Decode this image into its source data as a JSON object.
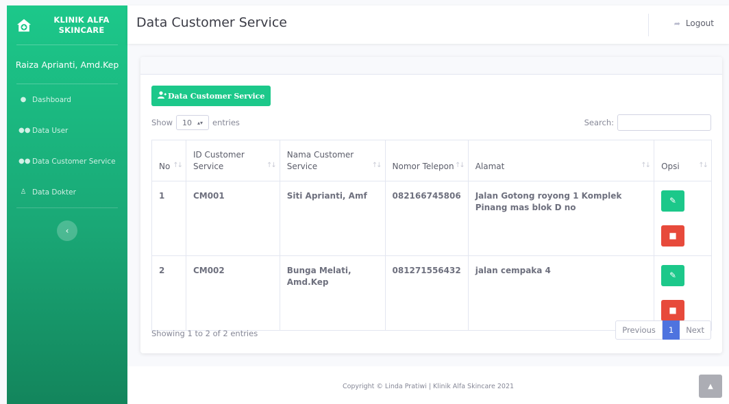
{
  "brand": {
    "name": "KLINIK ALFA SKINCARE",
    "icon": "clinic-home-icon"
  },
  "user": {
    "name": "Raiza Aprianti, Amd.Kep"
  },
  "sidebar": {
    "items": [
      {
        "label": "Dashboard",
        "icon": "palette-icon"
      },
      {
        "label": "Data User",
        "icon": "users-icon"
      },
      {
        "label": "Data Customer Service",
        "icon": "users-icon"
      },
      {
        "label": "Data Dokter",
        "icon": "doctor-icon"
      }
    ],
    "toggle_icon": "chevron-left-icon"
  },
  "header": {
    "title": "Data Customer Service",
    "logout_label": "Logout"
  },
  "main": {
    "add_button_label": "Data Customer Service",
    "show_label": "Show",
    "entries_label": "entries",
    "entries_value": "10",
    "search_label": "Search:",
    "table": {
      "columns": [
        "No",
        "ID Customer Service",
        "Nama Customer Service",
        "Nomor Telepon",
        "Alamat",
        "Opsi"
      ],
      "rows": [
        {
          "no": "1",
          "id": "CM001",
          "nama": "Siti Aprianti, Amf",
          "telepon": "082166745806",
          "alamat": "Jalan Gotong royong 1 Komplek Pinang mas blok D no"
        },
        {
          "no": "2",
          "id": "CM002",
          "nama": "Bunga Melati, Amd.Kep",
          "telepon": "081271556432",
          "alamat": "jalan cempaka 4"
        }
      ]
    },
    "info": "Showing 1 to 2 of 2 entries",
    "pagination": {
      "previous": "Previous",
      "current": "1",
      "next": "Next"
    }
  },
  "footer": {
    "copyright": "Copyright © Linda Pratiwi | Klinik Alfa Skincare 2021"
  },
  "colors": {
    "primary_green": "#1cc88a",
    "danger": "#e74a3b",
    "active_page": "#4e73df"
  }
}
